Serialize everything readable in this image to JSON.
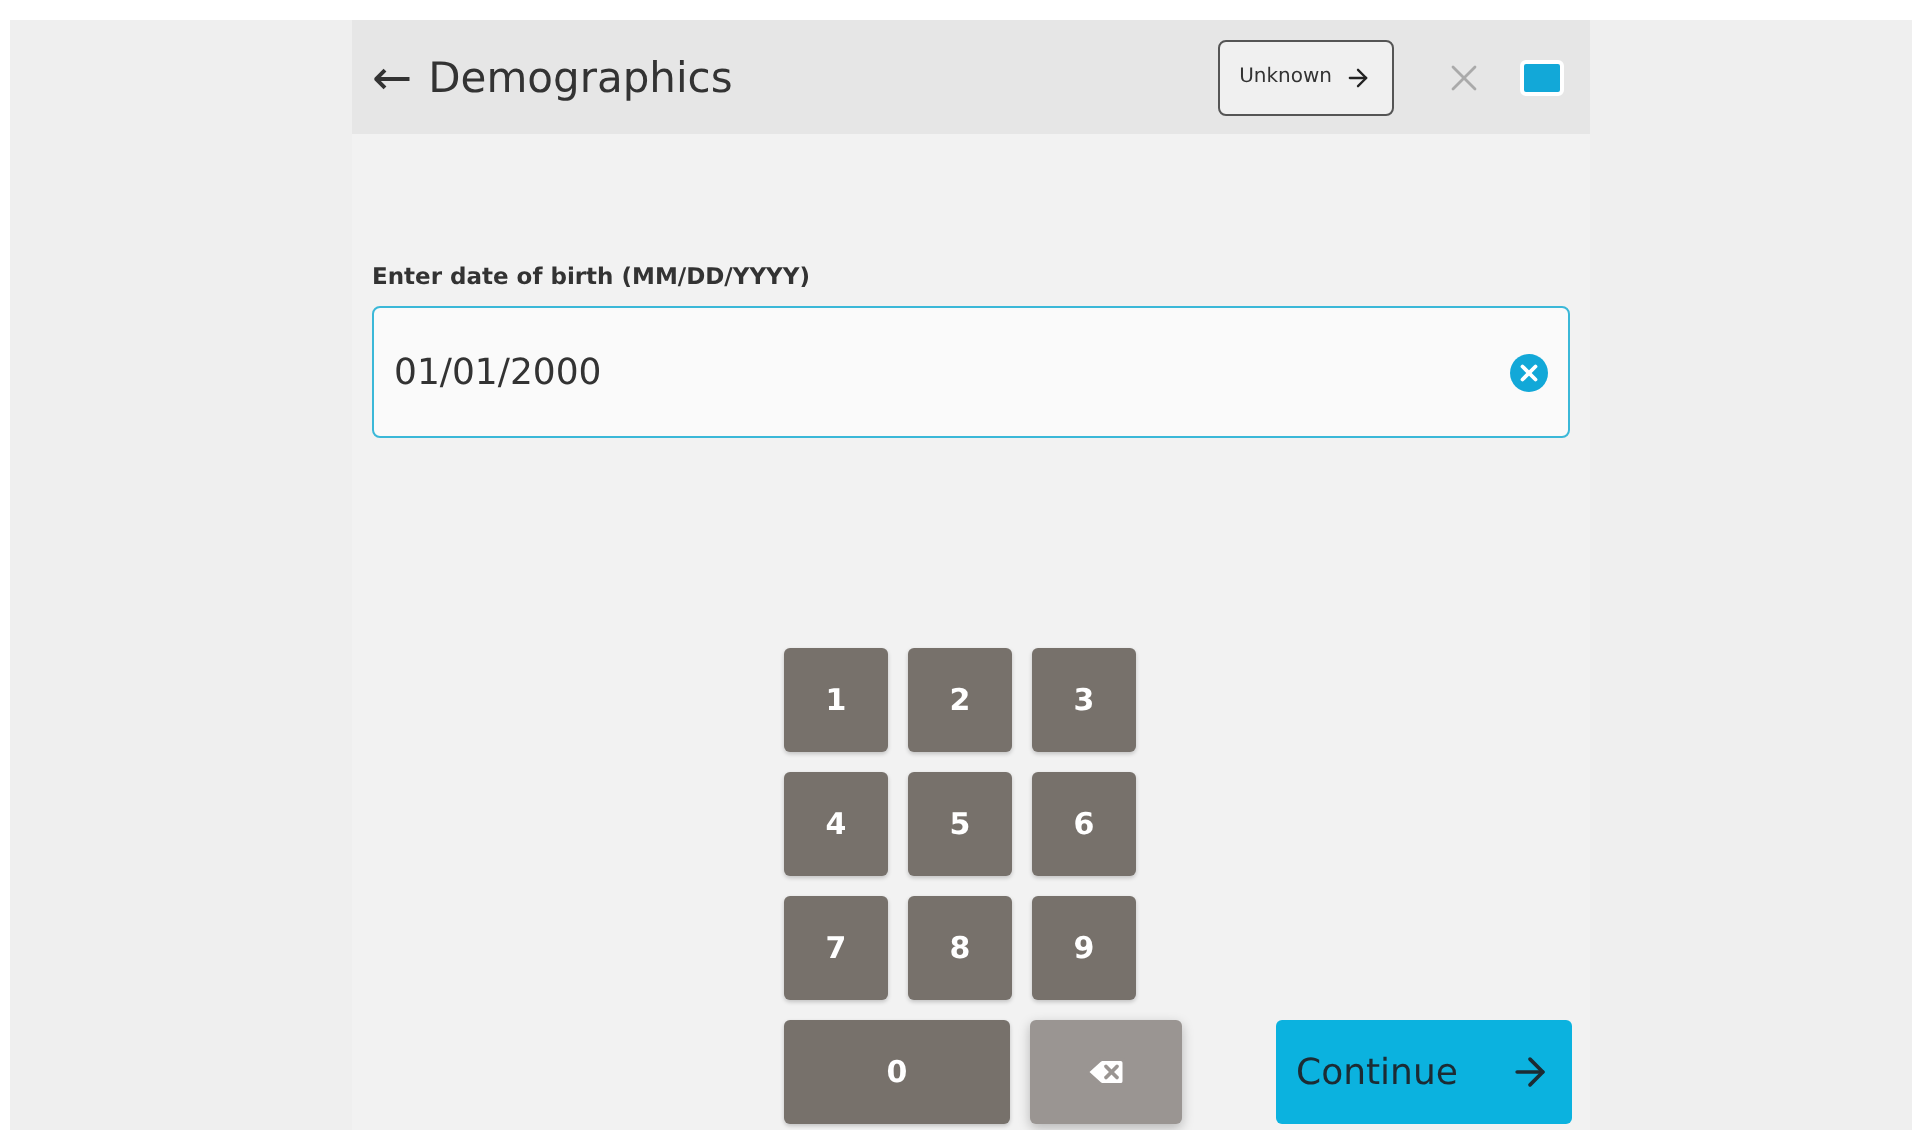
{
  "header": {
    "back_icon": "←",
    "title": "Demographics",
    "unknown_button": "Unknown"
  },
  "field": {
    "label": "Enter date of birth (MM/DD/YYYY)",
    "value": "01/01/2000"
  },
  "keypad": [
    {
      "kind": "digit",
      "label": "1"
    },
    {
      "kind": "digit",
      "label": "2"
    },
    {
      "kind": "digit",
      "label": "3"
    },
    {
      "kind": "digit",
      "label": "4"
    },
    {
      "kind": "digit",
      "label": "5"
    },
    {
      "kind": "digit",
      "label": "6"
    },
    {
      "kind": "digit",
      "label": "7"
    },
    {
      "kind": "digit",
      "label": "8"
    },
    {
      "kind": "digit",
      "label": "9"
    },
    {
      "kind": "wide",
      "label": "0"
    },
    {
      "kind": "backspace"
    }
  ],
  "continue_button": "Continue"
}
